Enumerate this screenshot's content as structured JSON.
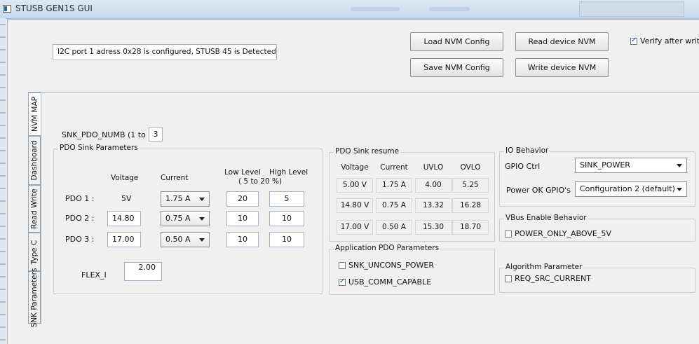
{
  "window": {
    "title": "STUSB GEN1S GUI"
  },
  "status_text": "I2C port 1 adress 0x28 is configured, STUSB 45 is Detected",
  "buttons": {
    "load_nvm": "Load NVM Config",
    "save_nvm": "Save NVM Config",
    "read_nvm": "Read device NVM",
    "write_nvm": "Write device NVM"
  },
  "verify": {
    "label": "Verify after write",
    "checked": true
  },
  "tabs": [
    "NVM MAP",
    "Dashboard",
    "Read Write",
    "Type C",
    "SNK Parameters"
  ],
  "snk_pdo_numb": {
    "label": "SNK_PDO_NUMB (1 to 3)",
    "value": "3"
  },
  "pdo_sink": {
    "title": "PDO Sink Parameters",
    "headers": {
      "voltage": "Voltage",
      "current": "Current",
      "low_level": "Low Level",
      "range": "( 5 to 20 %)",
      "high_level": "High Level"
    },
    "rows": [
      {
        "label": "PDO 1 :",
        "voltage": "5V",
        "current": "1.75 A",
        "low": "20",
        "high": "5"
      },
      {
        "label": "PDO 2 :",
        "voltage": "14.80",
        "current": "0.75 A",
        "low": "10",
        "high": "10"
      },
      {
        "label": "PDO 3 :",
        "voltage": "17.00",
        "current": "0.50 A",
        "low": "10",
        "high": "10"
      }
    ],
    "flex": {
      "label": "FLEX_I",
      "value": "2.00"
    }
  },
  "resume": {
    "title": "PDO Sink resume",
    "headers": [
      "Voltage",
      "Current",
      "UVLO",
      "OVLO"
    ],
    "rows": [
      [
        "5.00 V",
        "1.75 A",
        "4.00",
        "5.25"
      ],
      [
        "14.80 V",
        "0.75 A",
        "13.32",
        "16.28"
      ],
      [
        "17.00 V",
        "0.50 A",
        "15.30",
        "18.70"
      ]
    ]
  },
  "app_pdo": {
    "title": "Application PDO Parameters",
    "snk_uncons": {
      "label": "SNK_UNCONS_POWER",
      "checked": false
    },
    "usb_comm": {
      "label": "USB_COMM_CAPABLE",
      "checked": true
    }
  },
  "io": {
    "title": "IO Behavior",
    "gpio_label": "GPIO Ctrl",
    "gpio_value": "SINK_POWER",
    "power_ok_label": "Power OK GPIO's",
    "power_ok_value": "Configuration 2 (default)"
  },
  "vbus": {
    "title": "VBus Enable Behavior",
    "label": "POWER_ONLY_ABOVE_5V",
    "checked": false
  },
  "algo": {
    "title": "Algorithm Parameter",
    "label": "REQ_SRC_CURRENT",
    "checked": false
  }
}
